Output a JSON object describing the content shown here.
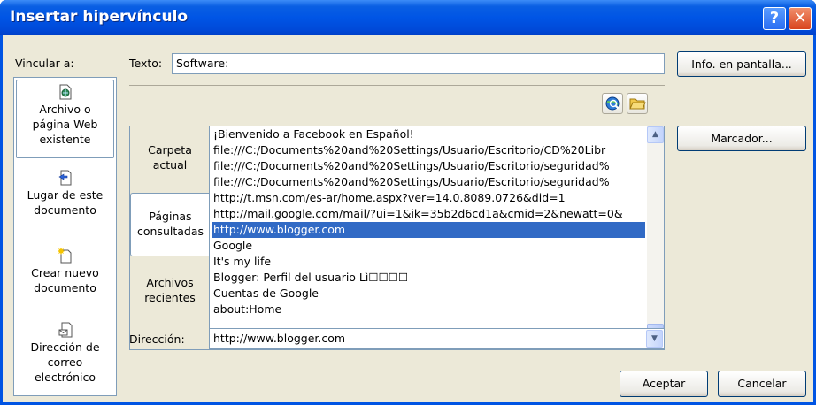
{
  "window": {
    "title": "Insertar hipervínculo",
    "help_glyph": "?",
    "close_glyph": "✕"
  },
  "link_to": {
    "label": "Vincular a:",
    "items": [
      {
        "line1": "Archivo o",
        "line2": "página Web",
        "line3": "existente",
        "icon": "web-file-icon",
        "selected": true
      },
      {
        "line1": "Lugar de este",
        "line2": "documento",
        "line3": "",
        "icon": "document-place-icon",
        "selected": false
      },
      {
        "line1": "Crear nuevo",
        "line2": "documento",
        "line3": "",
        "icon": "new-document-icon",
        "selected": false
      },
      {
        "line1": "Dirección de",
        "line2": "correo",
        "line3": "electrónico",
        "icon": "email-icon",
        "selected": false
      }
    ]
  },
  "text_field": {
    "label": "Texto:",
    "value": "Software:"
  },
  "screen_tip_button": "Info. en pantalla...",
  "bookmark_button": "Marcador...",
  "toolbar": {
    "browse_web_icon": "globe-search-icon",
    "browse_file_icon": "open-folder-icon"
  },
  "categories": [
    {
      "line1": "Carpeta",
      "line2": "actual",
      "selected": false
    },
    {
      "line1": "Páginas",
      "line2": "consultadas",
      "selected": true
    },
    {
      "line1": "Archivos",
      "line2": "recientes",
      "selected": false
    }
  ],
  "list_items": [
    "¡Bienvenido a Facebook en Español!",
    "file:///C:/Documents%20and%20Settings/Usuario/Escritorio/CD%20Libr",
    "file:///C:/Documents%20and%20Settings/Usuario/Escritorio/seguridad%",
    "file:///C:/Documents%20and%20Settings/Usuario/Escritorio/seguridad%",
    "http://t.msn.com/es-ar/home.aspx?ver=14.0.8089.0726&did=1",
    "http://mail.google.com/mail/?ui=1&ik=35b2d6cd1a&cmid=2&newatt=0&",
    "http://www.blogger.com",
    "Google",
    "It's my life",
    "Blogger: Perfil del usuario Lì☐☐☐☐",
    "Cuentas de Google",
    "about:Home"
  ],
  "selected_index": 6,
  "scroll_up_glyph": "▲",
  "scroll_down_glyph": "▼",
  "address": {
    "label": "Dirección:",
    "value": "http://www.blogger.com",
    "arrow_glyph": "▼"
  },
  "accept_button": "Aceptar",
  "cancel_button": "Cancelar",
  "colors": {
    "title_bar": "#0054e3",
    "dialog_bg": "#ece9d8",
    "selection": "#316ac5",
    "border": "#7f9db9"
  }
}
